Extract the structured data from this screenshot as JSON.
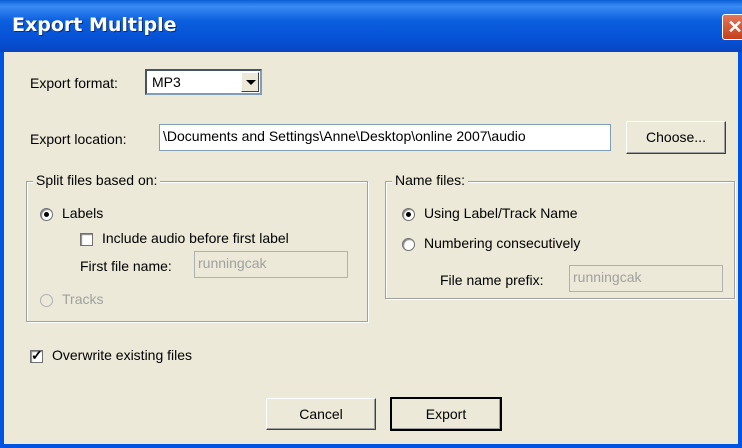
{
  "window": {
    "title": "Export Multiple",
    "close_glyph": "✕"
  },
  "export_format": {
    "label": "Export format:",
    "value": "MP3"
  },
  "export_location": {
    "label": "Export location:",
    "value": "\\Documents and Settings\\Anne\\Desktop\\online 2007\\audio",
    "choose_label": "Choose..."
  },
  "split_group": {
    "legend": "Split files based on:",
    "labels_option": "Labels",
    "include_audio_label": "Include audio before first label",
    "first_file_label": "First file name:",
    "first_file_value": "runningcak",
    "tracks_option": "Tracks"
  },
  "name_group": {
    "legend": "Name files:",
    "using_label_option": "Using Label/Track Name",
    "numbering_option": "Numbering consecutively",
    "prefix_label": "File name prefix:",
    "prefix_value": "runningcak"
  },
  "overwrite": {
    "label": "Overwrite existing files",
    "checked": true
  },
  "buttons": {
    "cancel": "Cancel",
    "export": "Export"
  }
}
